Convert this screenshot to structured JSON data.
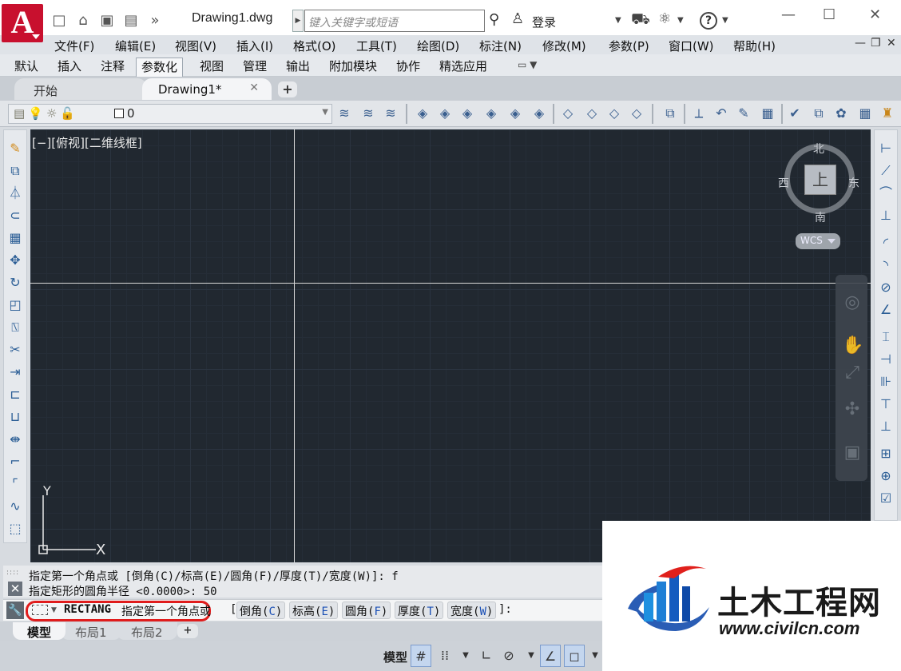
{
  "title_bar": {
    "app_logo": "A",
    "doc_title": "Drawing1.dwg",
    "search_placeholder": "键入关键字或短语",
    "login": "登录"
  },
  "menu": [
    "文件(F)",
    "编辑(E)",
    "视图(V)",
    "插入(I)",
    "格式(O)",
    "工具(T)",
    "绘图(D)",
    "标注(N)",
    "修改(M)",
    "参数(P)",
    "窗口(W)",
    "帮助(H)"
  ],
  "ribbon_tabs": [
    "默认",
    "插入",
    "注释",
    "参数化",
    "视图",
    "管理",
    "输出",
    "附加模块",
    "协作",
    "精选应用"
  ],
  "ribbon_active": "参数化",
  "doc_tabs": {
    "start": "开始",
    "drawing": "Drawing1*"
  },
  "layer": {
    "name": "0"
  },
  "viewport": {
    "label": "[−][俯视][二维线框]",
    "viewcube": {
      "top": "上",
      "north": "北",
      "south": "南",
      "east": "东",
      "west": "西",
      "wcs": "WCS"
    },
    "ucs": {
      "x": "X",
      "y": "Y"
    }
  },
  "command": {
    "history": [
      "指定第一个角点或 [倒角(C)/标高(E)/圆角(F)/厚度(T)/宽度(W)]: f",
      "指定矩形的圆角半径 <0.0000>: 50"
    ],
    "current_command": "RECTANG",
    "prompt": "指定第一个角点或",
    "options": [
      {
        "label": "倒角",
        "key": "C"
      },
      {
        "label": "标高",
        "key": "E"
      },
      {
        "label": "圆角",
        "key": "F"
      },
      {
        "label": "厚度",
        "key": "T"
      },
      {
        "label": "宽度",
        "key": "W"
      }
    ]
  },
  "layout_tabs": [
    "模型",
    "布局1",
    "布局2"
  ],
  "status": {
    "model": "模型"
  },
  "watermark": {
    "name": "土木工程网",
    "url": "www.civilcn.com"
  },
  "colors": {
    "canvas": "#212830",
    "highlight": "#e01c1c",
    "logo_red": "#c8102e",
    "option_key": "#1a4fb5"
  }
}
